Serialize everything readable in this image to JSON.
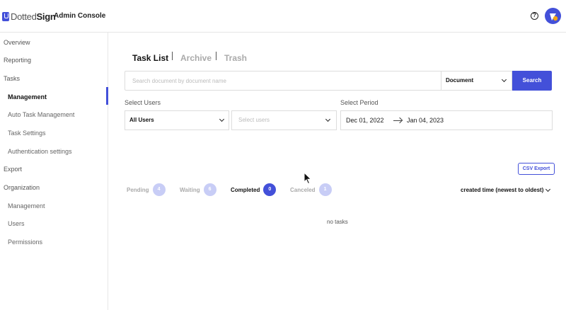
{
  "header": {
    "logo_part1": "Dotted",
    "logo_part2": "Sign",
    "app_title": "Admin Console",
    "help_glyph": "?",
    "icons": {
      "help": "help-circle-icon",
      "avatar": "user-avatar-icon"
    },
    "accent_color": "#4350d9"
  },
  "sidebar": {
    "items": [
      {
        "label": "Overview",
        "sub": false,
        "active": false
      },
      {
        "label": "Reporting",
        "sub": false,
        "active": false
      },
      {
        "label": "Tasks",
        "sub": false,
        "active": false
      },
      {
        "label": "Management",
        "sub": true,
        "active": true
      },
      {
        "label": "Auto Task Management",
        "sub": true,
        "active": false
      },
      {
        "label": "Task Settings",
        "sub": true,
        "active": false
      },
      {
        "label": "Authentication settings",
        "sub": true,
        "active": false
      },
      {
        "label": "Export",
        "sub": false,
        "active": false
      },
      {
        "label": "Organization",
        "sub": false,
        "active": false
      },
      {
        "label": "Management",
        "sub": true,
        "active": false
      },
      {
        "label": "Users",
        "sub": true,
        "active": false
      },
      {
        "label": "Permissions",
        "sub": true,
        "active": false
      }
    ]
  },
  "tabs": [
    {
      "label": "Task List",
      "active": true
    },
    {
      "label": "Archive",
      "active": false
    },
    {
      "label": "Trash",
      "active": false
    }
  ],
  "search": {
    "placeholder": "Search document by document name",
    "scope_value": "Document",
    "button_label": "Search"
  },
  "filters": {
    "users_label": "Select Users",
    "users_value": "All Users",
    "users_multi_placeholder": "Select users",
    "period_label": "Select Period",
    "period_from": "Dec 01, 2022",
    "period_to": "Jan 04, 2023"
  },
  "csv_export_label": "CSV Export",
  "statuses": [
    {
      "label": "Pending",
      "count": "4",
      "active": false
    },
    {
      "label": "Waiting",
      "count": "6",
      "active": false
    },
    {
      "label": "Completed",
      "count": "0",
      "active": true
    },
    {
      "label": "Canceled",
      "count": "1",
      "active": false
    }
  ],
  "sort_label": "created time (newest to oldest)",
  "empty_message": "no tasks"
}
